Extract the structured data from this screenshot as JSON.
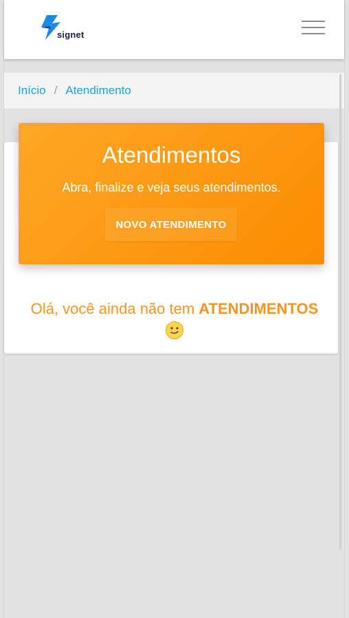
{
  "header": {
    "logo_text": "signet",
    "menu_icon": "hamburger-menu-icon"
  },
  "breadcrumb": {
    "items": [
      "Início",
      "Atendimento"
    ],
    "separator": "/"
  },
  "hero": {
    "title": "Atendimentos",
    "subtitle": "Abra, finalize e veja seus atendimentos.",
    "button_label": "NOVO ATENDIMENTO"
  },
  "empty_state": {
    "prefix": "Olá, você ainda não tem ",
    "highlight": "ATENDIMENTOS",
    "emoji": "smile-emoji-icon"
  },
  "colors": {
    "accent": "#fb8c00",
    "link": "#1ba3d6",
    "empty_text": "#f7941d"
  }
}
